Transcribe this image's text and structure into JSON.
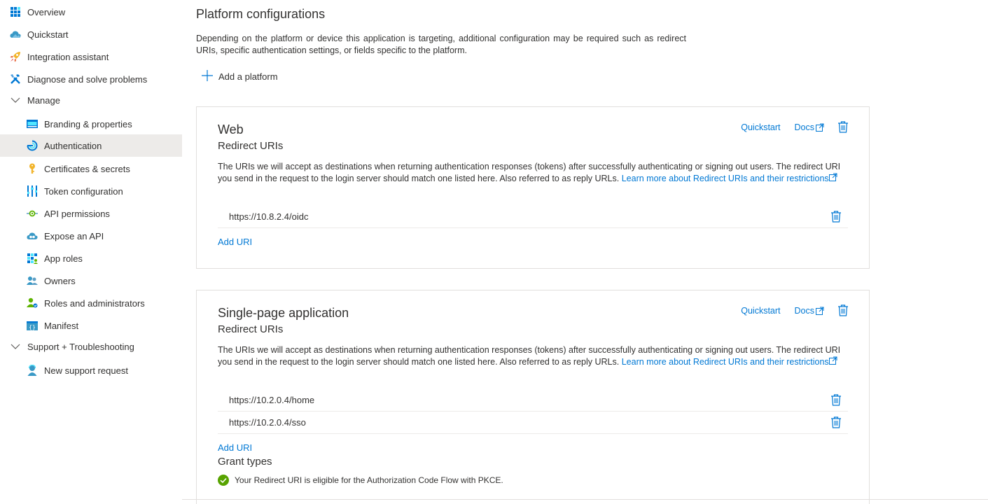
{
  "sidebar": {
    "items": [
      {
        "label": "Overview",
        "icon": "overview-grid-icon"
      },
      {
        "label": "Quickstart",
        "icon": "cloud-quickstart-icon"
      },
      {
        "label": "Integration assistant",
        "icon": "rocket-icon"
      },
      {
        "label": "Diagnose and solve problems",
        "icon": "wrench-icon"
      },
      {
        "label": "Manage",
        "icon": "chevron-down-icon"
      },
      {
        "label": "Branding & properties",
        "icon": "branding-icon"
      },
      {
        "label": "Authentication",
        "icon": "authentication-icon"
      },
      {
        "label": "Certificates & secrets",
        "icon": "key-icon"
      },
      {
        "label": "Token configuration",
        "icon": "token-bars-icon"
      },
      {
        "label": "API permissions",
        "icon": "api-permissions-icon"
      },
      {
        "label": "Expose an API",
        "icon": "cloud-api-icon"
      },
      {
        "label": "App roles",
        "icon": "app-roles-grid-icon"
      },
      {
        "label": "Owners",
        "icon": "owners-people-icon"
      },
      {
        "label": "Roles and administrators",
        "icon": "roles-admin-icon"
      },
      {
        "label": "Manifest",
        "icon": "manifest-icon"
      },
      {
        "label": "Support + Troubleshooting",
        "icon": "chevron-down-icon"
      },
      {
        "label": "New support request",
        "icon": "support-person-icon"
      }
    ],
    "selected": "Authentication"
  },
  "main": {
    "title": "Platform configurations",
    "description": "Depending on the platform or device this application is targeting, additional configuration may be required such as redirect URIs, specific authentication settings, or fields specific to the platform.",
    "add_platform": "Add a platform"
  },
  "web": {
    "title": "Web",
    "subtitle": "Redirect URIs",
    "quickstart": "Quickstart",
    "docs": "Docs",
    "text": "The URIs we will accept as destinations when returning authentication responses (tokens) after successfully authenticating or signing out users. The redirect URI you send in the request to the login server should match one listed here. Also referred to as reply URLs.",
    "learn_more": "Learn more about Redirect URIs and their restrictions",
    "uris": [
      "https://10.8.2.4/oidc"
    ],
    "add_uri": "Add URI"
  },
  "spa": {
    "title": "Single-page application",
    "subtitle": "Redirect URIs",
    "quickstart": "Quickstart",
    "docs": "Docs",
    "text": "The URIs we will accept as destinations when returning authentication responses (tokens) after successfully authenticating or signing out users. The redirect URI you send in the request to the login server should match one listed here. Also referred to as reply URLs.",
    "learn_more": "Learn more about Redirect URIs and their restrictions",
    "uris": [
      "https://10.2.0.4/home",
      "https://10.2.0.4/sso"
    ],
    "add_uri": "Add URI",
    "grant_types_title": "Grant types",
    "grant_status": "Your Redirect URI is eligible for the Authorization Code Flow with PKCE."
  },
  "colors": {
    "accent": "#0078d4",
    "selected_bg": "#edebe9",
    "success": "#57a300",
    "border": "#e1dfdd"
  }
}
